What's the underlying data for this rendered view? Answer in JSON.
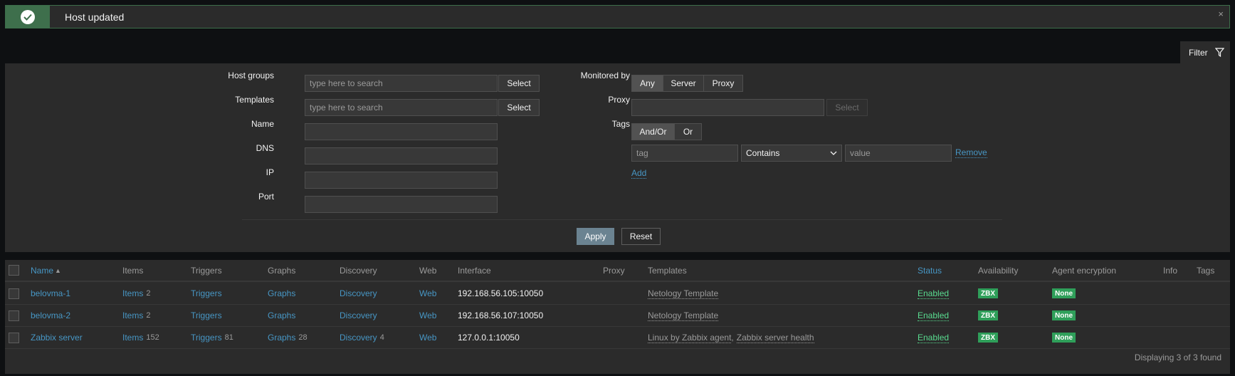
{
  "message": {
    "text": "Host updated",
    "close": "×"
  },
  "filter_tab": {
    "label": "Filter"
  },
  "filter": {
    "host_groups": {
      "label": "Host groups",
      "placeholder": "type here to search",
      "select": "Select"
    },
    "templates": {
      "label": "Templates",
      "placeholder": "type here to search",
      "select": "Select"
    },
    "name": {
      "label": "Name",
      "value": ""
    },
    "dns": {
      "label": "DNS",
      "value": ""
    },
    "ip": {
      "label": "IP",
      "value": ""
    },
    "port": {
      "label": "Port",
      "value": ""
    },
    "monitored_by": {
      "label": "Monitored by",
      "options": [
        "Any",
        "Server",
        "Proxy"
      ],
      "selected": "Any"
    },
    "proxy": {
      "label": "Proxy",
      "value": "",
      "select": "Select"
    },
    "tags": {
      "label": "Tags",
      "options": [
        "And/Or",
        "Or"
      ],
      "selected": "And/Or",
      "row": {
        "tag_placeholder": "tag",
        "operator": "Contains",
        "value_placeholder": "value",
        "remove": "Remove"
      },
      "add": "Add"
    },
    "apply": "Apply",
    "reset": "Reset"
  },
  "table": {
    "headers": {
      "name": "Name",
      "sort": "▲",
      "items": "Items",
      "triggers": "Triggers",
      "graphs": "Graphs",
      "discovery": "Discovery",
      "web": "Web",
      "interface": "Interface",
      "proxy": "Proxy",
      "templates": "Templates",
      "status": "Status",
      "availability": "Availability",
      "agent_encryption": "Agent encryption",
      "info": "Info",
      "tags": "Tags"
    },
    "rows": [
      {
        "name": "belovma-1",
        "items": "Items",
        "items_count": "2",
        "triggers": "Triggers",
        "triggers_count": "",
        "graphs": "Graphs",
        "graphs_count": "",
        "discovery": "Discovery",
        "discovery_count": "",
        "web": "Web",
        "interface": "192.168.56.105:10050",
        "template1": "Netology Template",
        "template_sep": "",
        "template2": "",
        "status": "Enabled",
        "availability": "ZBX",
        "encryption": "None"
      },
      {
        "name": "belovma-2",
        "items": "Items",
        "items_count": "2",
        "triggers": "Triggers",
        "triggers_count": "",
        "graphs": "Graphs",
        "graphs_count": "",
        "discovery": "Discovery",
        "discovery_count": "",
        "web": "Web",
        "interface": "192.168.56.107:10050",
        "template1": "Netology Template",
        "template_sep": "",
        "template2": "",
        "status": "Enabled",
        "availability": "ZBX",
        "encryption": "None"
      },
      {
        "name": "Zabbix server",
        "items": "Items",
        "items_count": "152",
        "triggers": "Triggers",
        "triggers_count": "81",
        "graphs": "Graphs",
        "graphs_count": "28",
        "discovery": "Discovery",
        "discovery_count": "4",
        "web": "Web",
        "interface": "127.0.0.1:10050",
        "template1": "Linux by Zabbix agent",
        "template_sep": ",",
        "template2": "Zabbix server health",
        "status": "Enabled",
        "availability": "ZBX",
        "encryption": "None"
      }
    ],
    "footer": "Displaying 3 of 3 found"
  },
  "colors": {
    "accent_link": "#4796c4",
    "enabled": "#59db8f",
    "badge": "#2f9f5a",
    "success_bg": "#3e6f4c"
  }
}
